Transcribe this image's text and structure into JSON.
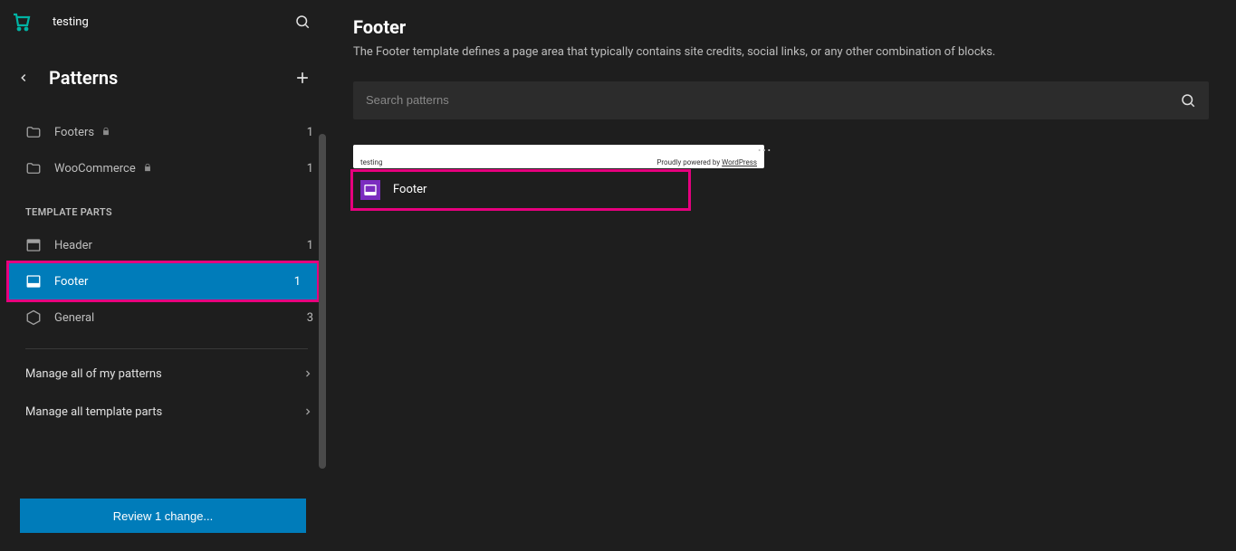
{
  "header": {
    "site_title": "testing"
  },
  "sidebar": {
    "title": "Patterns",
    "pattern_groups": [
      {
        "label": "Footers",
        "locked": true,
        "count": "1"
      },
      {
        "label": "WooCommerce",
        "locked": true,
        "count": "1"
      }
    ],
    "section_label": "TEMPLATE PARTS",
    "template_parts": [
      {
        "label": "Header",
        "count": "1",
        "active": false
      },
      {
        "label": "Footer",
        "count": "1",
        "active": true,
        "highlighted": true
      },
      {
        "label": "General",
        "count": "3",
        "active": false
      }
    ],
    "manage_links": [
      "Manage all of my patterns",
      "Manage all template parts"
    ],
    "review_button": "Review 1 change..."
  },
  "main": {
    "title": "Footer",
    "description": "The Footer template defines a page area that typically contains site credits, social links, or any other combination of blocks.",
    "search_placeholder": "Search patterns",
    "card": {
      "part_name": "Footer",
      "preview_left": "testing",
      "preview_right_prefix": "Proudly powered by ",
      "preview_right_link": "WordPress"
    }
  }
}
